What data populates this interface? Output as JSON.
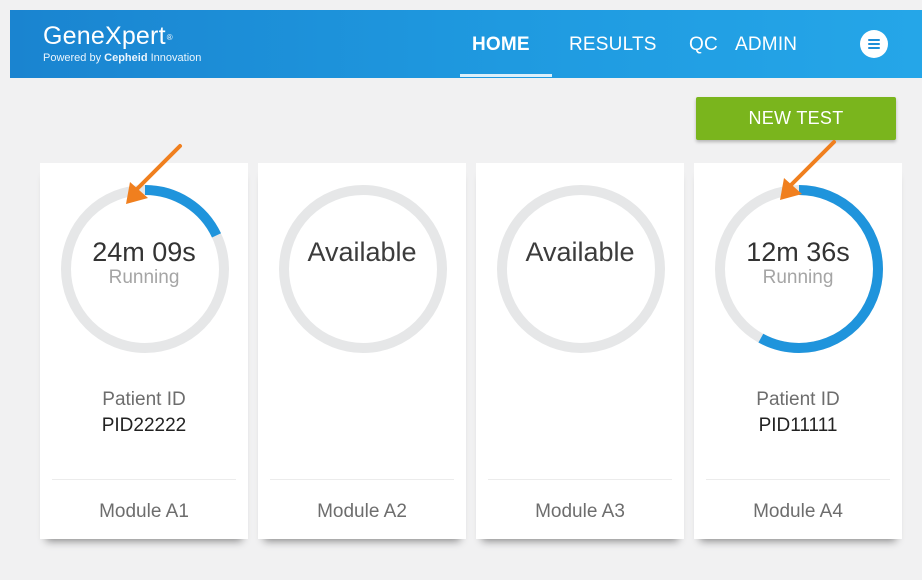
{
  "header": {
    "brand": "GeneXpert",
    "trademark": "®",
    "tagline_prefix": "Powered by",
    "tagline_brand": "Cepheid",
    "tagline_suffix": "Innovation",
    "nav": {
      "home": "HOME",
      "results": "RESULTS",
      "qc": "QC",
      "admin": "ADMIN"
    },
    "active_tab": "HOME"
  },
  "new_test_label": "NEW TEST",
  "modules": [
    {
      "name": "Module A1",
      "status": "Running",
      "time": "24m 09s",
      "patient_label": "Patient ID",
      "patient_id": "PID22222",
      "progress": 0.18
    },
    {
      "name": "Module A2",
      "status": "Available"
    },
    {
      "name": "Module A3",
      "status": "Available"
    },
    {
      "name": "Module A4",
      "status": "Running",
      "time": "12m 36s",
      "patient_label": "Patient ID",
      "patient_id": "PID11111",
      "progress": 0.58
    }
  ],
  "colors": {
    "header_blue": "#1f9ae0",
    "progress_blue": "#1f94dc",
    "track_gray": "#e6e7e8",
    "new_test_green": "#7ab51d",
    "annotation_arrow": "#f07f1e"
  }
}
